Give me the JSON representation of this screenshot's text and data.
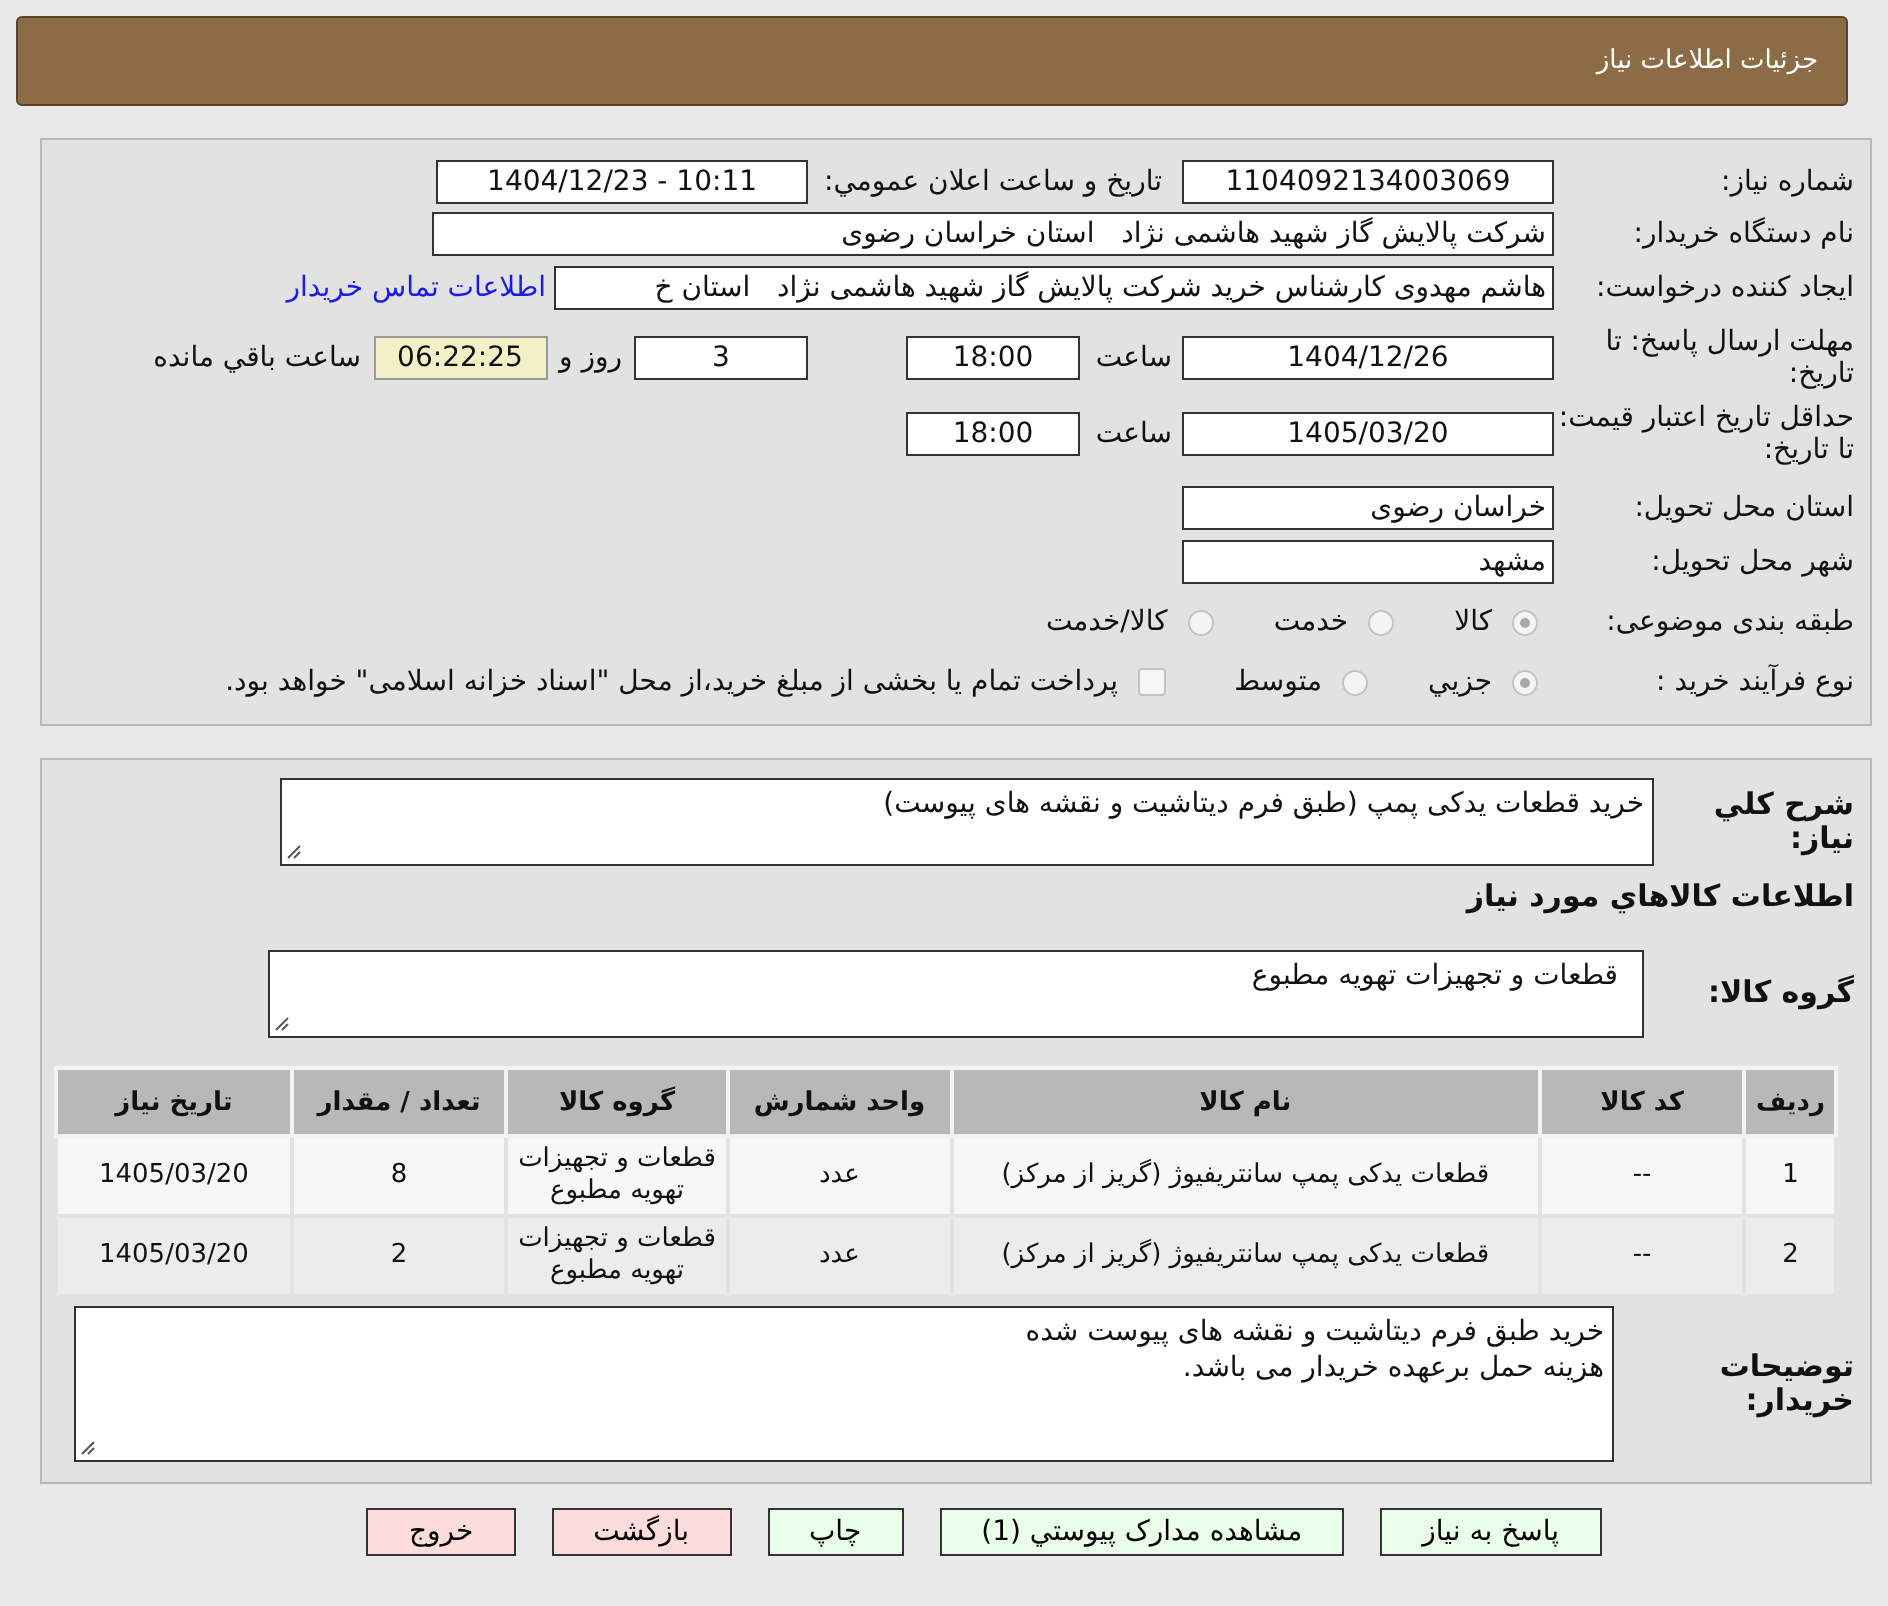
{
  "header": {
    "title": "جزئیات اطلاعات نیاز"
  },
  "need_number": {
    "label": "شماره نیاز:",
    "value": "1104092134003069"
  },
  "announce": {
    "label": "تاریخ و ساعت اعلان عمومي:",
    "value": "1404/12/23 - 10:11"
  },
  "buyer": {
    "label": "نام دستگاه خریدار:",
    "value": "شرکت پالایش گاز شهید هاشمی نژاد   استان خراسان رضوی"
  },
  "creator": {
    "label": "ایجاد کننده درخواست:",
    "value": "هاشم مهدوی کارشناس خرید شرکت پالایش گاز شهید هاشمی نژاد   استان خ",
    "link": "اطلاعات تماس خریدار"
  },
  "deadline": {
    "label": "مهلت ارسال پاسخ: تا تاریخ:",
    "date": "1404/12/26",
    "time_label": "ساعت",
    "time": "18:00",
    "days": "3",
    "days_label": "روز و",
    "remaining": "06:22:25",
    "remaining_label": "ساعت باقي مانده"
  },
  "validity": {
    "label": "حداقل تاریخ اعتبار قیمت: تا تاریخ:",
    "date": "1405/03/20",
    "time_label": "ساعت",
    "time": "18:00"
  },
  "province": {
    "label": "استان محل تحویل:",
    "value": "خراسان رضوی"
  },
  "city": {
    "label": "شهر محل تحویل:",
    "value": "مشهد"
  },
  "category": {
    "label": "طبقه بندی موضوعی:",
    "options": [
      {
        "label": "کالا",
        "selected": true
      },
      {
        "label": "خدمت",
        "selected": false
      },
      {
        "label": "کالا/خدمت",
        "selected": false
      }
    ]
  },
  "process": {
    "label": "نوع فرآیند خرید :",
    "options": [
      {
        "label": "جزيي",
        "selected": true
      },
      {
        "label": "متوسط",
        "selected": false
      }
    ],
    "treasury": {
      "label": "پرداخت تمام یا بخشی از مبلغ خرید،از محل \"اسناد خزانه اسلامی\" خواهد بود.",
      "checked": false
    }
  },
  "summary": {
    "label": "شرح کلي نياز:",
    "value": "خرید قطعات یدکی پمپ (طبق فرم دیتاشیت و نقشه های پیوست)"
  },
  "goods_title": "اطلاعات کالاهاي مورد نياز",
  "goods_group": {
    "label": "گروه کالا:",
    "value": "قطعات و تجهیزات تهویه مطبوع"
  },
  "table": {
    "columns": [
      "ردیف",
      "کد کالا",
      "نام کالا",
      "واحد شمارش",
      "گروه کالا",
      "تعداد / مقدار",
      "تاریخ نیاز"
    ],
    "rows": [
      [
        "1",
        "--",
        "قطعات یدکی پمپ سانتریفیوژ (گریز از مرکز)",
        "عدد",
        "قطعات و تجهیزات تهویه مطبوع",
        "8",
        "1405/03/20"
      ],
      [
        "2",
        "--",
        "قطعات یدکی پمپ سانتریفیوژ (گریز از مرکز)",
        "عدد",
        "قطعات و تجهیزات تهویه مطبوع",
        "2",
        "1405/03/20"
      ]
    ]
  },
  "notes": {
    "label": "توضیحات خریدار:",
    "lines": [
      "خرید طبق فرم دیتاشیت و نقشه های پیوست شده",
      "هزینه حمل برعهده خریدار می باشد."
    ]
  },
  "buttons": [
    {
      "label": "پاسخ به نیاز",
      "kind": "primary"
    },
    {
      "label": "مشاهده مدارک پیوستي (1)",
      "kind": "primary"
    },
    {
      "label": "چاپ",
      "kind": "primary"
    },
    {
      "label": "بازگشت",
      "kind": "danger"
    },
    {
      "label": "خروج",
      "kind": "danger"
    }
  ]
}
